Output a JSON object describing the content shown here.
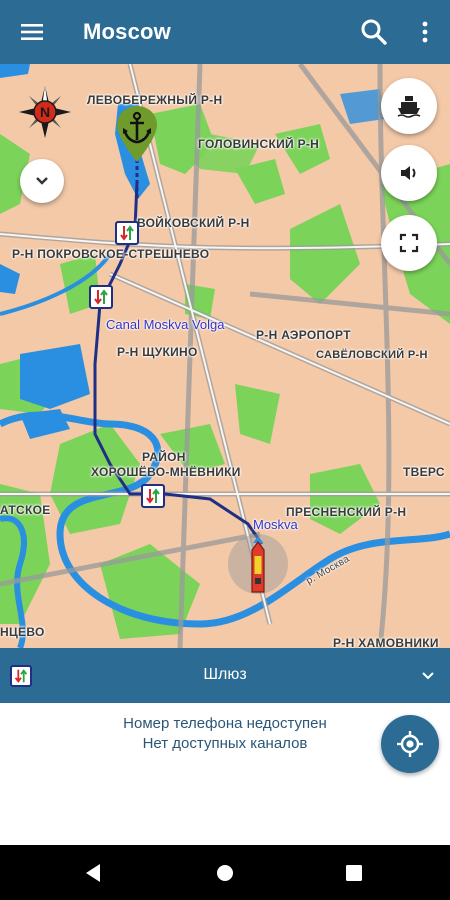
{
  "app": {
    "title": "Moscow"
  },
  "icons": {
    "menu": "menu-icon",
    "search": "search-icon",
    "more": "more-vert-icon",
    "compass": "compass-rose-icon",
    "anchor": "anchor-marker-icon",
    "collapse": "chevron-down-icon",
    "ship": "ship-icon",
    "sound": "volume-icon",
    "fullscreen": "fullscreen-icon",
    "lock": "lock-icon",
    "boat": "boat-position-icon",
    "locate": "my-location-icon",
    "back": "back-icon",
    "home": "home-icon",
    "recents": "recents-icon"
  },
  "map": {
    "labels": {
      "levoberezhny": "ЛЕВОБЕРЕЖНЫЙ Р-Н",
      "golovinsky": "ГОЛОВИНСКИЙ Р-Н",
      "voykovsky": "ВОЙКОВСКИЙ Р-Н",
      "pokrovskoe": "Р-Н ПОКРОВСКОЕ-СТРЕШНЕВО",
      "canal": "Canal Moskva Volga",
      "aeroport": "Р-Н АЭРОПОРТ",
      "shchukino": "Р-Н ЩУКИНО",
      "savelovsky": "САВЁЛОВСКИЙ Р-Н",
      "rayon": "РАЙОН",
      "khoroshevo": "ХОРОШЁВО-МНЁВНИКИ",
      "tverskoy": "ТВЕРС",
      "matskoe": "АТСКОЕ",
      "presnensky": "ПРЕСНЕНСКИЙ Р-Н",
      "moskva": "Moskva",
      "river": "р. Москва",
      "ntsevo": "НЦЕВО",
      "khamovniki": "Р-Н ХАМОВНИКИ"
    }
  },
  "panel": {
    "title": "Шлюз",
    "phone": "Номер телефона недоступен",
    "channels": "Нет доступных каналов"
  },
  "colors": {
    "primary": "#2b6b94",
    "route": "#1f2f86",
    "water": "#2a8fe0",
    "park": "#7cd35a",
    "land": "#f3c9a8"
  }
}
